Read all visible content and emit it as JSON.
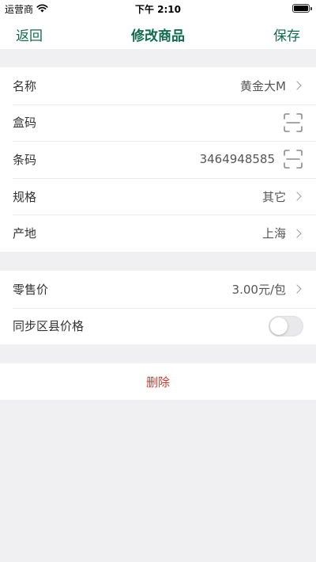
{
  "status_bar": {
    "carrier": "运营商",
    "time": "下午 2:10"
  },
  "nav": {
    "back_label": "返回",
    "title": "修改商品",
    "save_label": "保存"
  },
  "form": {
    "name": {
      "label": "名称",
      "value": "黄金大M"
    },
    "box_code": {
      "label": "盒码",
      "value": ""
    },
    "barcode": {
      "label": "条码",
      "value": "3464948585"
    },
    "spec": {
      "label": "规格",
      "value": "其它"
    },
    "origin": {
      "label": "产地",
      "value": "上海"
    }
  },
  "pricing": {
    "retail_price": {
      "label": "零售价",
      "value": "3.00元/包"
    },
    "sync_county": {
      "label": "同步区县价格",
      "enabled": false
    }
  },
  "actions": {
    "delete_label": "删除"
  },
  "colors": {
    "accent": "#0e6b4c",
    "danger": "#d03a2d",
    "background": "#f0f0f2"
  }
}
